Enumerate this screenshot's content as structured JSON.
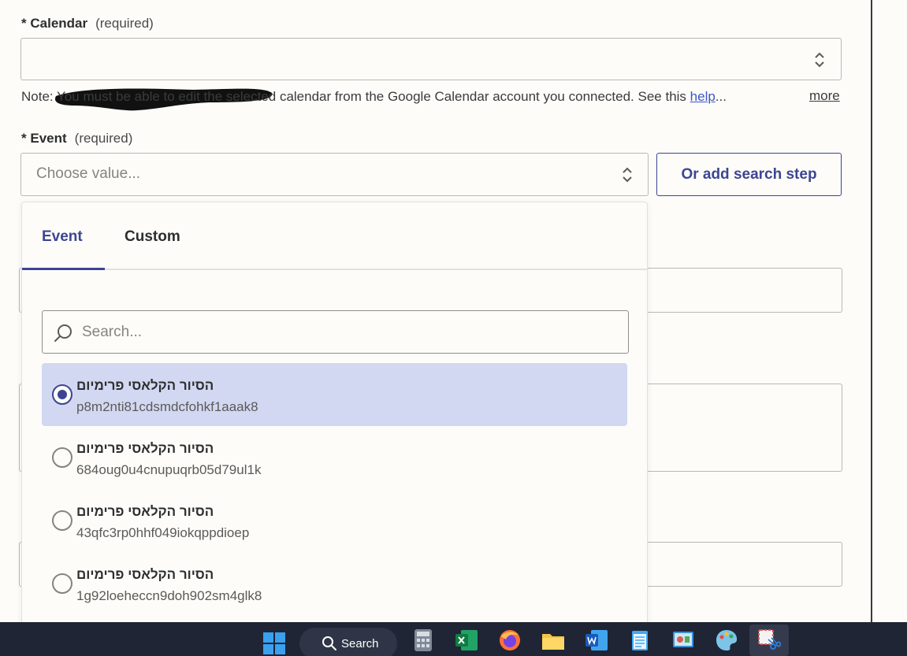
{
  "calendar": {
    "asterisk": "*",
    "label": "Calendar",
    "required": "(required)",
    "value_redacted": "redacted"
  },
  "note": {
    "text": "Note: You must be able to edit the selected calendar from the Google Calendar account you connected. See this ",
    "link": "help",
    "ellipsis": "...",
    "more": "more"
  },
  "event": {
    "asterisk": "*",
    "label": "Event",
    "required": "(required)",
    "placeholder": "Choose value...",
    "search_step_button": "Or add search step"
  },
  "dropdown": {
    "tabs": [
      "Event",
      "Custom"
    ],
    "active_tab": "Event",
    "search_placeholder": "Search...",
    "options": [
      {
        "title": "הסיור הקלאסי פרימיום",
        "id": "p8m2nti81cdsmdcfohkf1aaak8",
        "selected": true
      },
      {
        "title": "הסיור הקלאסי פרימיום",
        "id": "684oug0u4cnupuqrb05d79ul1k",
        "selected": false
      },
      {
        "title": "הסיור הקלאסי פרימיום",
        "id": "43qfc3rp0hhf049iokqppdioep",
        "selected": false
      },
      {
        "title": "הסיור הקלאסי פרימיום",
        "id": "1g92loeheccn9doh902sm4glk8",
        "selected": false
      }
    ]
  },
  "taskbar": {
    "search_label": "Search",
    "apps": [
      "windows-start",
      "calculator",
      "excel",
      "firefox",
      "file-explorer",
      "word",
      "notepad",
      "control-panel",
      "paint",
      "snipping-tool"
    ]
  },
  "colors": {
    "accent": "#3d4592",
    "selected_bg": "#d2d8f2",
    "page_bg": "#fdfcf9",
    "link": "#3c57c4",
    "taskbar": "#1f2535"
  }
}
